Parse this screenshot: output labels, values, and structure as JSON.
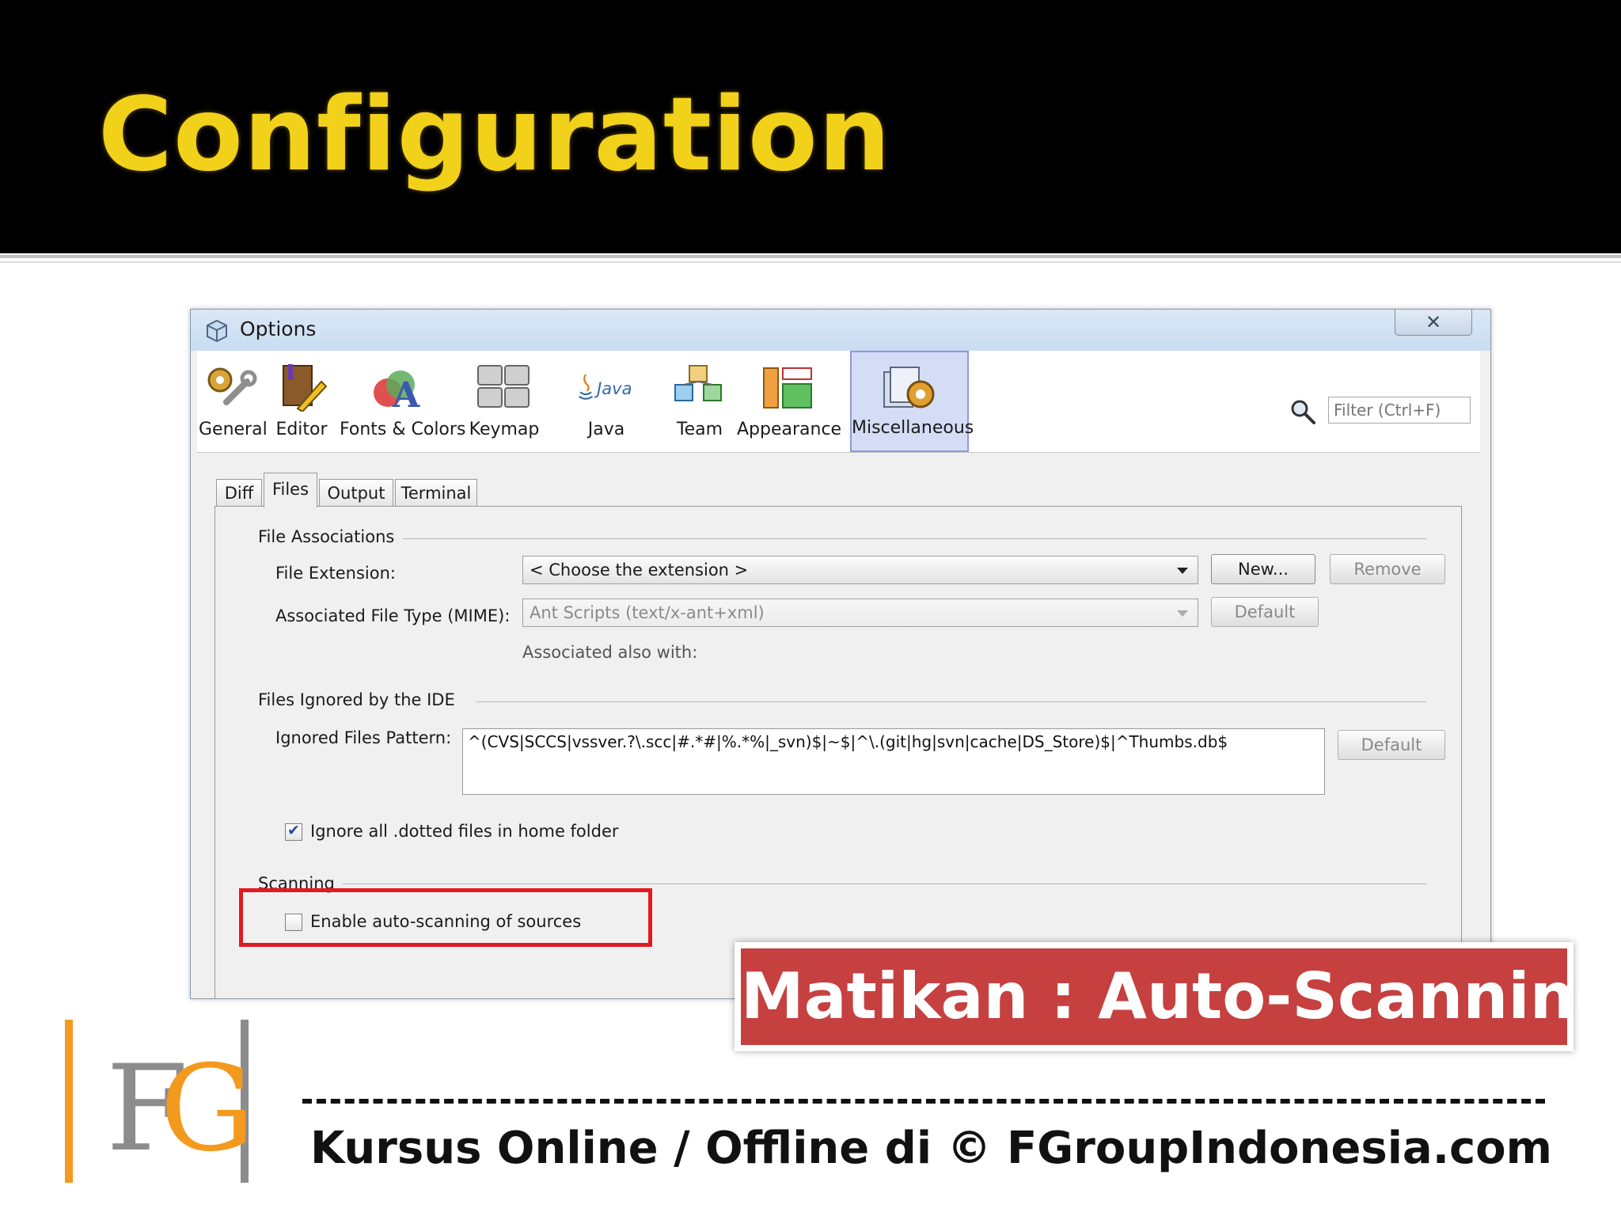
{
  "slide": {
    "title": "Configuration",
    "banner": "Matikan : Auto-Scanning",
    "footer": "Kursus Online / Offline di © FGroupIndonesia.com",
    "logo_text": "FG"
  },
  "window": {
    "title": "Options",
    "close_icon": "close-icon",
    "filter_placeholder": "Filter (Ctrl+F)"
  },
  "categories": [
    {
      "label": "General",
      "icon": "general-icon",
      "selected": false
    },
    {
      "label": "Editor",
      "icon": "editor-icon",
      "selected": false
    },
    {
      "label": "Fonts & Colors",
      "icon": "fonts-colors-icon",
      "selected": false
    },
    {
      "label": "Keymap",
      "icon": "keymap-icon",
      "selected": false
    },
    {
      "label": "Java",
      "icon": "java-icon",
      "selected": false
    },
    {
      "label": "Team",
      "icon": "team-icon",
      "selected": false
    },
    {
      "label": "Appearance",
      "icon": "appearance-icon",
      "selected": false
    },
    {
      "label": "Miscellaneous",
      "icon": "miscellaneous-icon",
      "selected": true
    }
  ],
  "java_logo_text": "Java",
  "subtabs": [
    "Diff",
    "Files",
    "Output",
    "Terminal"
  ],
  "active_subtab": "Files",
  "file_associations": {
    "section_title": "File Associations",
    "extension_label": "File Extension:",
    "extension_value": "< Choose the extension >",
    "new_button": "New...",
    "remove_button": "Remove",
    "mime_label": "Associated File Type (MIME):",
    "mime_value": "Ant Scripts (text/x-ant+xml)",
    "default_button": "Default",
    "also_label": "Associated also with:"
  },
  "ignored": {
    "section_title": "Files Ignored by the IDE",
    "pattern_label": "Ignored Files Pattern:",
    "pattern_value": "^(CVS|SCCS|vssver.?\\.scc|#.*#|%.*%|_svn)$|~$|^\\.(git|hg|svn|cache|DS_Store)$|^Thumbs.db$",
    "default_button": "Default",
    "dotted_label": "Ignore all .dotted files in home folder",
    "dotted_checked": true
  },
  "scanning": {
    "section_title": "Scanning",
    "auto_label": "Enable auto-scanning of sources",
    "auto_checked": false
  },
  "colors": {
    "title_yellow": "#f2d11a",
    "banner_red": "#c64040",
    "highlight_red": "#e11a22",
    "logo_orange": "#f39a1e",
    "logo_gray": "#8c8c8c"
  }
}
